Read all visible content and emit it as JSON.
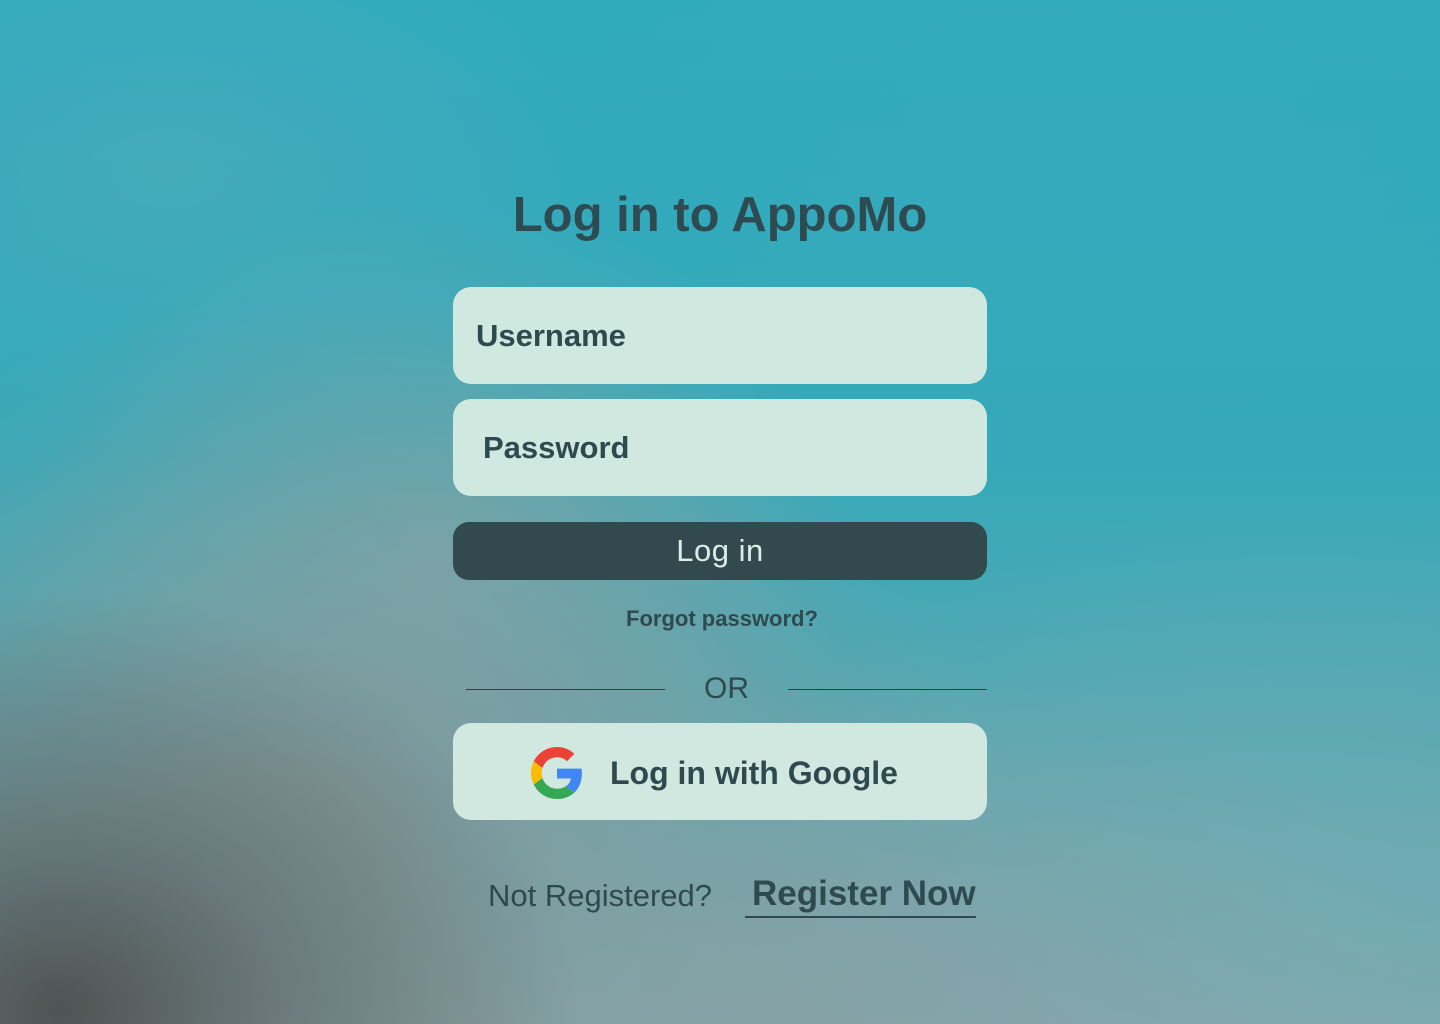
{
  "app": {
    "title": "Log in to AppoMo"
  },
  "form": {
    "username_placeholder": "Username",
    "password_placeholder": "Password",
    "login_label": "Log in",
    "forgot_label": "Forgot password?",
    "divider_label": "OR",
    "google_label": "Log in with Google",
    "google_icon": "google-g-icon"
  },
  "footer": {
    "prompt": "Not Registered?",
    "register_label": "Register Now"
  },
  "colors": {
    "background": "#33aabb",
    "field": "#cfe8e0",
    "primary_button": "#32494e",
    "text": "#2f4a4f"
  }
}
